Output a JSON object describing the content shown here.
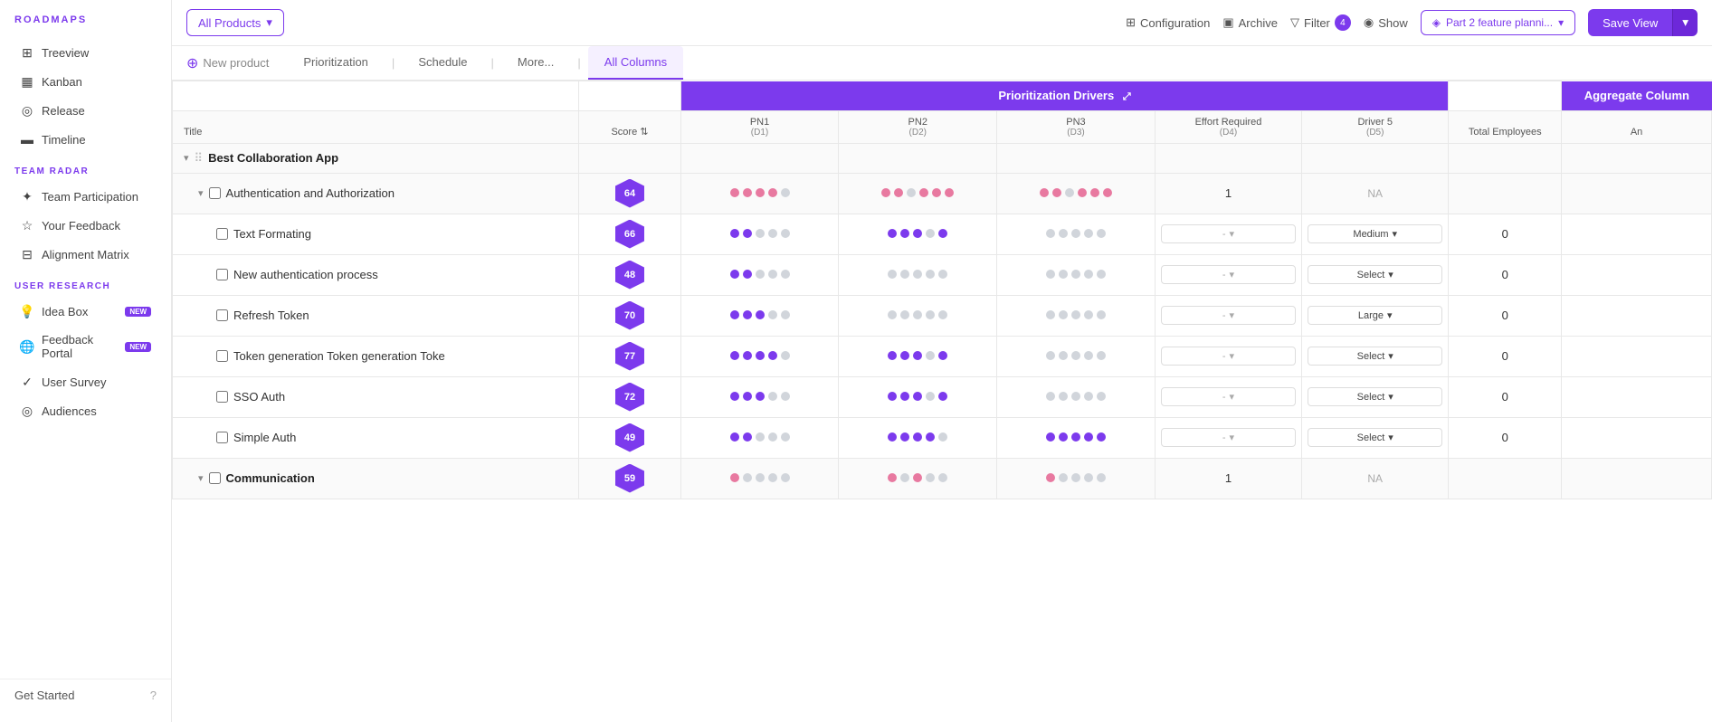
{
  "sidebar": {
    "logo": "ROADMAPS",
    "nav_items": [
      {
        "id": "treeview",
        "label": "Treeview",
        "icon": "⊞"
      },
      {
        "id": "kanban",
        "label": "Kanban",
        "icon": "▦"
      },
      {
        "id": "release",
        "label": "Release",
        "icon": "◎"
      },
      {
        "id": "timeline",
        "label": "Timeline",
        "icon": "▬"
      }
    ],
    "team_radar_label": "TEAM RADAR",
    "team_radar_items": [
      {
        "id": "team-participation",
        "label": "Team Participation",
        "icon": "✦"
      },
      {
        "id": "your-feedback",
        "label": "Your Feedback",
        "icon": "☆"
      },
      {
        "id": "alignment-matrix",
        "label": "Alignment Matrix",
        "icon": "⊟"
      }
    ],
    "user_research_label": "USER RESEARCH",
    "user_research_items": [
      {
        "id": "idea-box",
        "label": "Idea Box",
        "icon": "💡",
        "badge": "NEW"
      },
      {
        "id": "feedback-portal",
        "label": "Feedback Portal",
        "icon": "🌐",
        "badge": "NEW"
      },
      {
        "id": "user-survey",
        "label": "User Survey",
        "icon": "✓"
      },
      {
        "id": "audiences",
        "label": "Audiences",
        "icon": "◎"
      }
    ],
    "bottom_label": "Get Started"
  },
  "toolbar": {
    "product_dropdown": "All Products",
    "config_label": "Configuration",
    "archive_label": "Archive",
    "filter_label": "Filter",
    "filter_count": "4",
    "show_label": "Show",
    "plan_label": "Part 2 feature planni...",
    "save_view_label": "Save View"
  },
  "tabs": {
    "new_product": "New product",
    "items": [
      "Prioritization",
      "Schedule",
      "More...",
      "All Columns"
    ],
    "active": "All Columns"
  },
  "table": {
    "col_group_label": "Prioritization Drivers",
    "agg_col_label": "Aggregate Column",
    "col_headers": [
      {
        "id": "title",
        "label": "Title"
      },
      {
        "id": "score",
        "label": "Score",
        "icon": "⇅"
      },
      {
        "id": "pn1",
        "label": "PN1",
        "sub": "(D1)",
        "icon": "⇅"
      },
      {
        "id": "pn2",
        "label": "PN2",
        "sub": "(D2)",
        "icon": "⇅"
      },
      {
        "id": "pn3",
        "label": "PN3",
        "sub": "(D3)",
        "icon": "⇅"
      },
      {
        "id": "effort",
        "label": "Effort Required",
        "sub": "(D4)",
        "icon": "⇅"
      },
      {
        "id": "driver5",
        "label": "Driver 5",
        "sub": "(D5)",
        "icon": "⇅"
      },
      {
        "id": "total",
        "label": "Total Employees"
      },
      {
        "id": "an",
        "label": "An"
      }
    ],
    "groups": [
      {
        "id": "best-collab",
        "title": "Best Collaboration App",
        "score": "",
        "expanded": true,
        "rows": [
          {
            "id": "auth-authorization",
            "title": "Authentication and Authorization",
            "score": "64",
            "pn1_dots": [
              true,
              true,
              true,
              true,
              false
            ],
            "pn1_color": "pink",
            "pn2_dots": [
              true,
              true,
              false,
              true,
              true,
              true
            ],
            "pn2_color": "pink",
            "pn3_dots": [
              true,
              true,
              false,
              true,
              true,
              true
            ],
            "pn3_color": "pink",
            "effort": "1",
            "driver5": "NA",
            "total": "",
            "expanded": true,
            "is_parent": true,
            "children": [
              {
                "id": "text-formatting",
                "title": "Text Formating",
                "score": "66",
                "pn1_dots": [
                  true,
                  true,
                  false,
                  false,
                  false
                ],
                "pn1_color": "purple",
                "pn2_dots": [
                  true,
                  true,
                  true,
                  false,
                  true
                ],
                "pn2_color": "purple",
                "pn3_dots": [
                  false,
                  false,
                  false,
                  false,
                  false
                ],
                "pn3_color": "gray",
                "effort_val": "-",
                "driver5_val": "Medium",
                "total": "0"
              },
              {
                "id": "new-auth-process",
                "title": "New authentication process",
                "score": "48",
                "pn1_dots": [
                  true,
                  true,
                  false,
                  false,
                  false
                ],
                "pn1_color": "purple",
                "pn2_dots": [
                  false,
                  false,
                  false,
                  false,
                  false
                ],
                "pn2_color": "gray",
                "pn3_dots": [
                  false,
                  false,
                  false,
                  false,
                  false
                ],
                "pn3_color": "gray",
                "effort_val": "-",
                "driver5_val": "Select",
                "total": "0"
              },
              {
                "id": "refresh-token",
                "title": "Refresh Token",
                "score": "70",
                "pn1_dots": [
                  true,
                  true,
                  true,
                  false,
                  false
                ],
                "pn1_color": "purple",
                "pn2_dots": [
                  false,
                  false,
                  false,
                  false,
                  false
                ],
                "pn2_color": "gray",
                "pn3_dots": [
                  false,
                  false,
                  false,
                  false,
                  false
                ],
                "pn3_color": "gray",
                "effort_val": "-",
                "driver5_val": "Large",
                "total": "0"
              },
              {
                "id": "token-generation",
                "title": "Token generation Token generation Toke",
                "score": "77",
                "pn1_dots": [
                  true,
                  true,
                  true,
                  true,
                  false
                ],
                "pn1_color": "purple",
                "pn2_dots": [
                  true,
                  true,
                  true,
                  false,
                  true
                ],
                "pn2_color": "purple",
                "pn3_dots": [
                  false,
                  false,
                  false,
                  false,
                  false
                ],
                "pn3_color": "gray",
                "effort_val": "-",
                "driver5_val": "Select",
                "total": "0"
              },
              {
                "id": "sso-auth",
                "title": "SSO Auth",
                "score": "72",
                "pn1_dots": [
                  true,
                  true,
                  true,
                  false,
                  false
                ],
                "pn1_color": "purple",
                "pn2_dots": [
                  true,
                  true,
                  true,
                  false,
                  true
                ],
                "pn2_color": "purple",
                "pn3_dots": [
                  false,
                  false,
                  false,
                  false,
                  false
                ],
                "pn3_color": "gray",
                "effort_val": "-",
                "driver5_val": "Select",
                "total": "0"
              },
              {
                "id": "simple-auth",
                "title": "Simple Auth",
                "score": "49",
                "pn1_dots": [
                  true,
                  true,
                  false,
                  false,
                  false
                ],
                "pn1_color": "purple",
                "pn2_dots": [
                  true,
                  true,
                  true,
                  true,
                  false
                ],
                "pn2_color": "purple",
                "pn3_dots": [
                  true,
                  true,
                  true,
                  true,
                  true
                ],
                "pn3_color": "purple",
                "effort_val": "-",
                "driver5_val": "Select",
                "total": "0"
              }
            ]
          },
          {
            "id": "communication",
            "title": "Communication",
            "score": "59",
            "pn1_dots": [
              true,
              false,
              false,
              false,
              false
            ],
            "pn1_color": "pink",
            "pn2_dots": [
              true,
              false,
              true,
              false,
              false
            ],
            "pn2_color": "pink",
            "pn3_dots": [
              true,
              false,
              false,
              false,
              false
            ],
            "pn3_color": "pink",
            "effort": "1",
            "driver5": "NA",
            "total": "",
            "is_group": true
          }
        ]
      }
    ]
  }
}
